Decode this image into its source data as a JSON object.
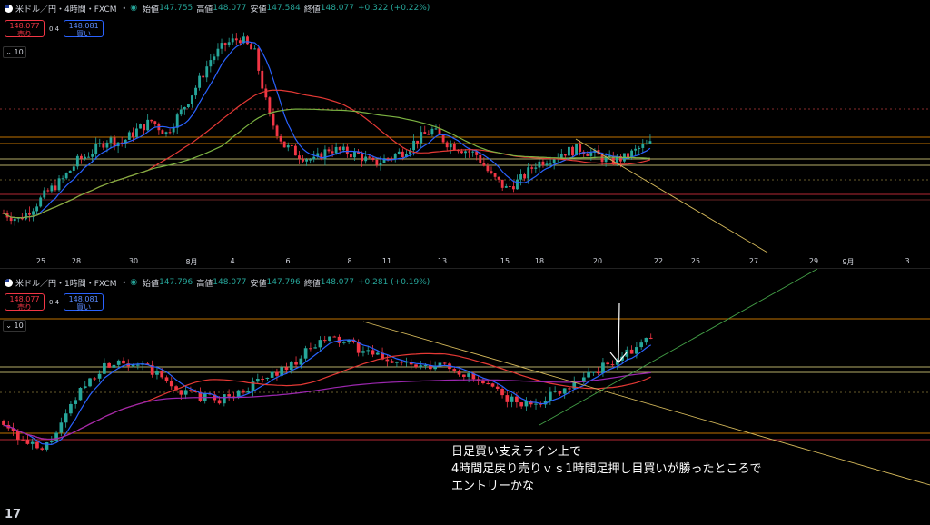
{
  "pane_top": {
    "symbol": "米ドル／円・4時間・FXCM",
    "open_label": "始値",
    "open": "147.755",
    "high_label": "高値",
    "high": "148.077",
    "low_label": "安値",
    "low": "147.584",
    "close_label": "終値",
    "close": "148.077",
    "change": "+0.322 (+0.22%)",
    "sell_price": "148.077",
    "sell_label": "売り",
    "spread": "0.4",
    "buy_price": "148.081",
    "buy_label": "買い",
    "indicator_count": "10",
    "x_labels": [
      "25",
      "28",
      "30",
      "8月",
      "4",
      "6",
      "8",
      "11",
      "13",
      "15",
      "18",
      "20",
      "22",
      "25",
      "27",
      "29",
      "9月",
      "3"
    ]
  },
  "pane_bottom": {
    "symbol": "米ドル／円・1時間・FXCM",
    "open_label": "始値",
    "open": "147.796",
    "high_label": "高値",
    "high": "148.077",
    "low_label": "安値",
    "low": "147.796",
    "close_label": "終値",
    "close": "148.077",
    "change": "+0.281 (+0.19%)",
    "sell_price": "148.077",
    "sell_label": "売り",
    "spread": "0.4",
    "buy_price": "148.081",
    "buy_label": "買い",
    "indicator_count": "10"
  },
  "annotation": {
    "line1": "日足買い支えライン上で",
    "line2": "4時間足戻り売りｖｓ1時間足押し目買いが勝ったところで",
    "line3": "エントリーかな"
  },
  "logo_text": "17",
  "colors": {
    "up": "#26a69a",
    "down": "#f23645",
    "ma_blue": "#2962ff",
    "ma_red": "#e53935",
    "ma_purple": "#9c27b0",
    "level_yellow": "#f0e68c",
    "level_orange": "#ff9800"
  },
  "chart_data": [
    {
      "type": "candlestick",
      "title": "米ドル／円・4時間・FXCM",
      "x_tick_labels": [
        "25",
        "28",
        "30",
        "8月",
        "4",
        "6",
        "8",
        "11",
        "13",
        "15",
        "18",
        "20",
        "22",
        "25",
        "27",
        "29",
        "9月",
        "3"
      ],
      "close_series": [
        145.2,
        145.0,
        145.4,
        145.9,
        146.3,
        146.9,
        147.2,
        147.6,
        147.5,
        147.9,
        148.2,
        147.8,
        148.5,
        149.3,
        150.2,
        150.7,
        150.9,
        150.4,
        148.3,
        147.4,
        147.1,
        146.9,
        147.3,
        147.2,
        147.1,
        146.8,
        147.0,
        147.2,
        147.6,
        147.9,
        147.5,
        147.3,
        147.1,
        146.4,
        146.0,
        146.3,
        146.8,
        147.0,
        147.2,
        147.3,
        147.1,
        146.9,
        147.0,
        147.3,
        147.5
      ],
      "last_close": 148.077,
      "series": [
        {
          "name": "MA blue"
        },
        {
          "name": "MA red"
        },
        {
          "name": "MA green"
        }
      ]
    },
    {
      "type": "candlestick",
      "title": "米ドル／円・1時間・FXCM",
      "close_series": [
        146.4,
        146.0,
        145.8,
        146.3,
        147.0,
        147.4,
        147.6,
        147.5,
        147.3,
        147.0,
        146.9,
        146.8,
        146.9,
        147.1,
        147.3,
        147.5,
        147.8,
        148.0,
        147.9,
        147.7,
        147.6,
        147.5,
        147.4,
        147.5,
        147.3,
        147.1,
        146.9,
        146.7,
        146.8,
        147.0,
        147.2,
        147.4,
        147.6,
        147.8,
        148.1
      ],
      "last_close": 148.077,
      "series": [
        {
          "name": "MA blue"
        },
        {
          "name": "MA red"
        },
        {
          "name": "MA purple"
        }
      ]
    }
  ]
}
